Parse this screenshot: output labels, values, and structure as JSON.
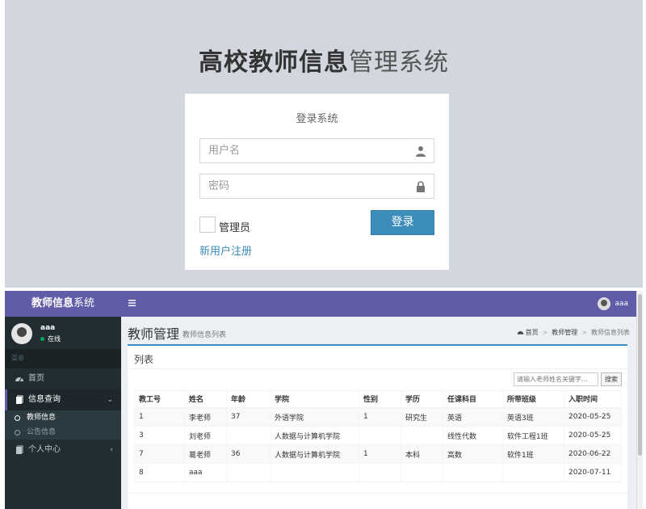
{
  "login": {
    "title_bold": "高校教师信息",
    "title_light": "管理系统",
    "heading": "登录系统",
    "username_placeholder": "用户名",
    "password_placeholder": "密码",
    "admin_checkbox_label": "管理员",
    "login_button": "登录",
    "register_link": "新用户注册"
  },
  "app": {
    "brand_bold": "教师信息",
    "brand_light": "系统",
    "top_user": "aaa",
    "sidebar": {
      "user_name": "aaa",
      "status": "在线",
      "menu_header": "菜单",
      "items": [
        {
          "label": "首页",
          "icon": "dashboard-icon"
        },
        {
          "label": "信息查询",
          "icon": "book-icon",
          "active": true,
          "caret": "⌄"
        },
        {
          "label": "个人中心",
          "icon": "book-icon",
          "caret": "‹"
        }
      ],
      "subitems": [
        {
          "label": "教师信息",
          "active": true
        },
        {
          "label": "公告信息",
          "active": false
        }
      ]
    },
    "page_title": "教师管理",
    "page_subtitle": "教师信息列表",
    "breadcrumb": [
      "首页",
      "教师管理",
      "教师信息列表"
    ],
    "box_title": "列表",
    "search_placeholder": "请输入老师姓名关键字...",
    "search_button": "搜索",
    "table": {
      "headers": [
        "教工号",
        "姓名",
        "年龄",
        "学院",
        "性别",
        "学历",
        "任课科目",
        "所带班级",
        "入职时间"
      ],
      "rows": [
        [
          "1",
          "李老师",
          "37",
          "外语学院",
          "1",
          "研究生",
          "英语",
          "英语3班",
          "2020-05-25"
        ],
        [
          "3",
          "刘老师",
          "",
          "人数据与计算机学院",
          "",
          "",
          "线性代数",
          "软件工程1班",
          "2020-05-25"
        ],
        [
          "7",
          "葛老师",
          "36",
          "人数据与计算机学院",
          "1",
          "本科",
          "高数",
          "软件1班",
          "2020-06-22"
        ],
        [
          "8",
          "aaa",
          "",
          "",
          "",
          "",
          "",
          "",
          "2020-07-11"
        ]
      ]
    }
  },
  "colors": {
    "accent_purple": "#605ca8",
    "primary_blue": "#3c8dbc",
    "sidebar_dark": "#222d32",
    "login_bg": "#d2d6de"
  }
}
